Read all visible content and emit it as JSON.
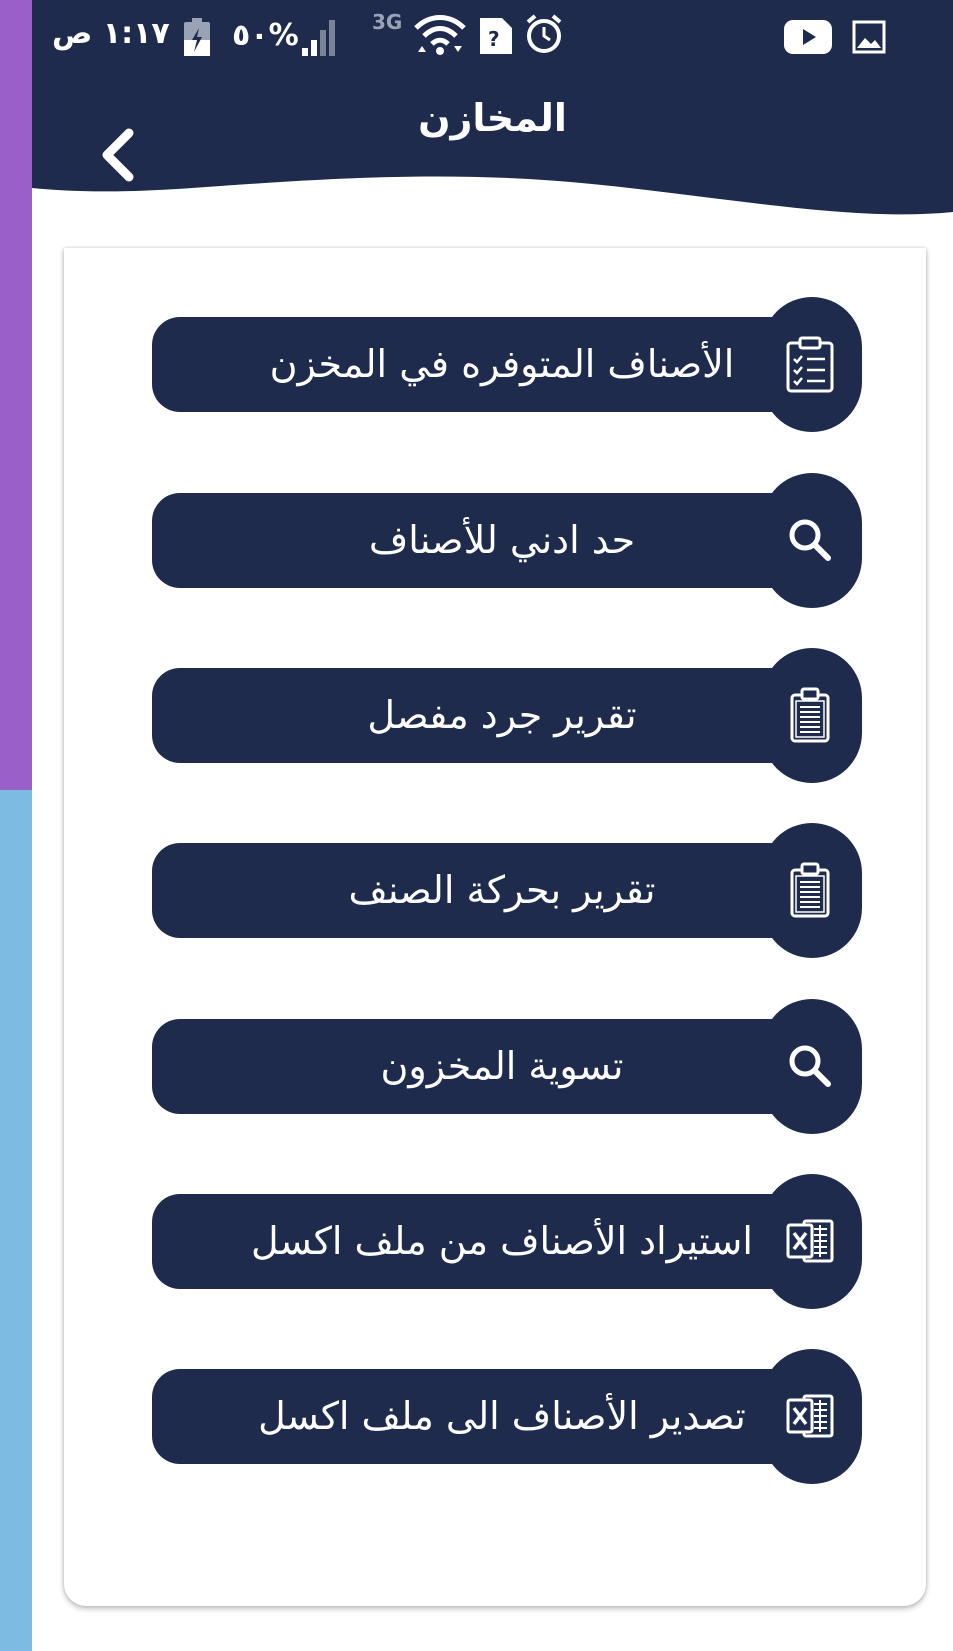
{
  "status_bar": {
    "time": "١:١٧ ص",
    "battery": "%٥٠",
    "network": "3G"
  },
  "header": {
    "title": "المخازن"
  },
  "menu": [
    {
      "label": "الأصناف المتوفره في المخزن",
      "icon": "checklist-icon"
    },
    {
      "label": "حد ادني للأصناف",
      "icon": "search-icon"
    },
    {
      "label": "تقرير جرد مفصل",
      "icon": "clipboard-icon"
    },
    {
      "label": "تقرير بحركة الصنف",
      "icon": "clipboard-icon"
    },
    {
      "label": "تسوية المخزون",
      "icon": "search-icon"
    },
    {
      "label": "استيراد الأصناف من ملف اكسل",
      "icon": "excel-icon"
    },
    {
      "label": "تصدير الأصناف الى ملف اكسل",
      "icon": "excel-icon"
    }
  ],
  "colors": {
    "primary": "#1f2b4d",
    "background": "#ffffff",
    "left_strip_top": "#9b5fc9",
    "left_strip_bottom": "#7dbbe2"
  }
}
